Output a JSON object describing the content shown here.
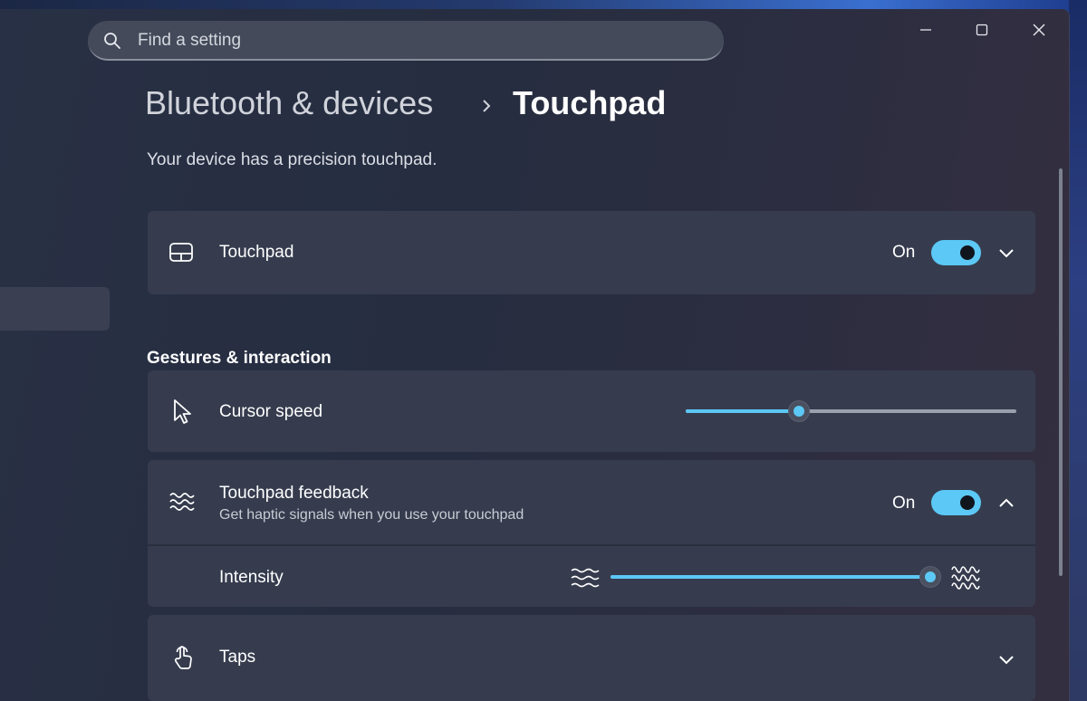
{
  "search": {
    "placeholder": "Find a setting"
  },
  "window_controls": {
    "minimize": "minimize-icon",
    "maximize": "maximize-icon",
    "close": "close-icon"
  },
  "breadcrumb": {
    "parent": "Bluetooth & devices",
    "current": "Touchpad"
  },
  "description": "Your device has a precision touchpad.",
  "touchpad": {
    "label": "Touchpad",
    "state": "On",
    "toggle_on": true,
    "icon": "touchpad-icon"
  },
  "gestures": {
    "title": "Gestures & interaction",
    "cursor_speed": {
      "label": "Cursor speed",
      "value": 0.34,
      "icon": "pointer-icon"
    },
    "feedback": {
      "label": "Touchpad feedback",
      "sublabel": "Get haptic signals when you use your touchpad",
      "state": "On",
      "toggle_on": true,
      "icon": "haptic-waves-icon",
      "intensity": {
        "label": "Intensity",
        "value": 1.0
      }
    },
    "taps": {
      "label": "Taps",
      "icon": "tap-icon"
    }
  },
  "colors": {
    "accent": "#5cc8f5",
    "card": "#363c4e",
    "background": "#272e41"
  }
}
